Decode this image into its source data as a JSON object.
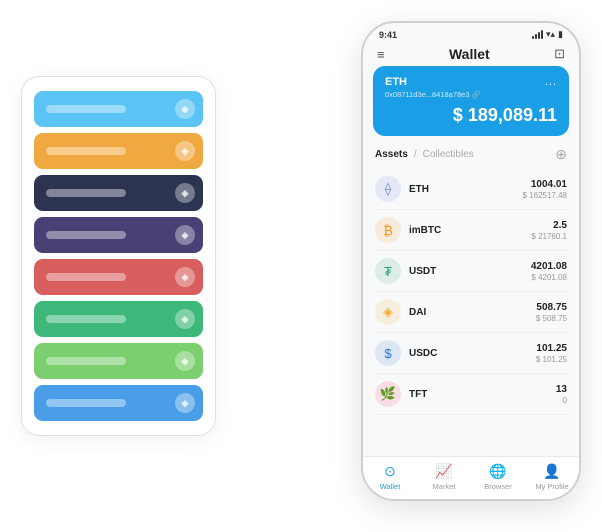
{
  "scene": {
    "cards": [
      {
        "color": "#5bc4f5",
        "label": "",
        "icon": "◈"
      },
      {
        "color": "#f0a940",
        "label": "",
        "icon": "◈"
      },
      {
        "color": "#2d3452",
        "label": "",
        "icon": "◈"
      },
      {
        "color": "#4a4075",
        "label": "",
        "icon": "◈"
      },
      {
        "color": "#d95f5f",
        "label": "",
        "icon": "◈"
      },
      {
        "color": "#3db87a",
        "label": "",
        "icon": "◈"
      },
      {
        "color": "#7bcf6e",
        "label": "",
        "icon": "◈"
      },
      {
        "color": "#4a9ee8",
        "label": "",
        "icon": "◈"
      }
    ]
  },
  "phone": {
    "statusBar": {
      "time": "9:41",
      "signalBars": [
        3,
        5,
        7,
        9,
        11
      ],
      "wifiLabel": "WiFi",
      "batteryLabel": "Battery"
    },
    "navBar": {
      "menuIcon": "≡",
      "title": "Wallet",
      "scanIcon": "⊡"
    },
    "walletCard": {
      "ethLabel": "ETH",
      "moreIcon": "...",
      "address": "0x08711d3e...8418a78e3",
      "addressSuffix": "🔗",
      "balance": "$ 189,089.11"
    },
    "assets": {
      "tabActive": "Assets",
      "tabDivider": "/",
      "tabInactive": "Collectibles",
      "addIcon": "⊕"
    },
    "assetList": [
      {
        "name": "ETH",
        "qty": "1004.01",
        "usd": "$ 162517.48",
        "color": "#627eea",
        "symbol": "⟠"
      },
      {
        "name": "imBTC",
        "qty": "2.5",
        "usd": "$ 21760.1",
        "color": "#f7931a",
        "symbol": "₿"
      },
      {
        "name": "USDT",
        "qty": "4201.08",
        "usd": "$ 4201.08",
        "color": "#26a17b",
        "symbol": "₮"
      },
      {
        "name": "DAI",
        "qty": "508.75",
        "usd": "$ 508.75",
        "color": "#f5ac37",
        "symbol": "◈"
      },
      {
        "name": "USDC",
        "qty": "101.25",
        "usd": "$ 101.25",
        "color": "#2775ca",
        "symbol": "$"
      },
      {
        "name": "TFT",
        "qty": "13",
        "usd": "0",
        "color": "#e8365d",
        "symbol": "🌿"
      }
    ],
    "bottomNav": [
      {
        "icon": "⊙",
        "label": "Wallet",
        "active": true
      },
      {
        "icon": "📈",
        "label": "Market",
        "active": false
      },
      {
        "icon": "🌐",
        "label": "Browser",
        "active": false
      },
      {
        "icon": "👤",
        "label": "My Profile",
        "active": false
      }
    ]
  }
}
